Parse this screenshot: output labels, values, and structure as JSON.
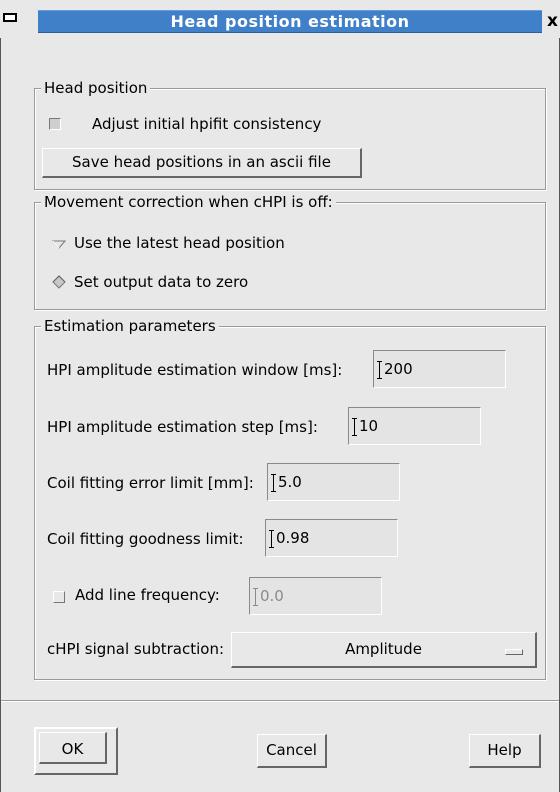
{
  "window": {
    "title": "Head position estimation",
    "close_glyph": "x"
  },
  "head_position": {
    "legend": "Head position",
    "adjust_checkbox": {
      "label": "Adjust initial hpifit consistency",
      "checked": true
    },
    "save_button": "Save head positions in an ascii file"
  },
  "movement_correction": {
    "legend": "Movement correction when cHPI is off:",
    "options": [
      {
        "label": "Use the latest head position",
        "selected": false
      },
      {
        "label": "Set output data to zero",
        "selected": true
      }
    ]
  },
  "estimation_parameters": {
    "legend": "Estimation parameters",
    "fields": [
      {
        "label": "HPI amplitude estimation window [ms]:",
        "value": "200"
      },
      {
        "label": "HPI amplitude estimation step [ms]:",
        "value": "10"
      },
      {
        "label": "Coil fitting error limit [mm]:",
        "value": "5.0"
      },
      {
        "label": "Coil fitting goodness limit:",
        "value": "0.98"
      }
    ],
    "line_frequency": {
      "label": "Add line frequency:",
      "value": "0.0",
      "checked": false
    },
    "signal_subtraction": {
      "label": "cHPI signal subtraction:",
      "selected": "Amplitude"
    }
  },
  "footer": {
    "ok": "OK",
    "cancel": "Cancel",
    "help": "Help"
  }
}
